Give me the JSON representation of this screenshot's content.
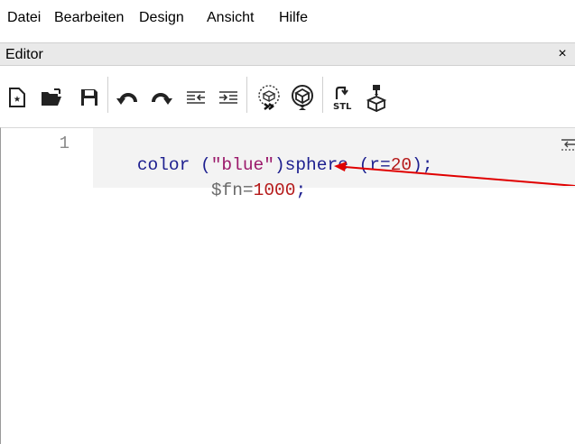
{
  "menu": [
    "Datei",
    "Bearbeiten",
    "Design",
    "Ansicht",
    "Hilfe"
  ],
  "panel": {
    "title": "Editor",
    "close_glyph": "×"
  },
  "toolbar": {
    "buttons": [
      {
        "name": "new-file-icon"
      },
      {
        "name": "open-file-icon"
      },
      {
        "name": "save-file-icon"
      },
      {
        "name": "undo-icon"
      },
      {
        "name": "redo-icon"
      },
      {
        "name": "unindent-icon"
      },
      {
        "name": "indent-icon"
      },
      {
        "name": "preview-icon"
      },
      {
        "name": "render-icon"
      },
      {
        "name": "export-stl-icon"
      },
      {
        "name": "send-to-print-icon"
      }
    ],
    "stl_label": "STL"
  },
  "editor": {
    "line_number": "1",
    "line1": {
      "t1": "color (",
      "t2": "\"blue\"",
      "t3": ")sphere (r=",
      "t4": "20",
      "t5": ");"
    },
    "line2": {
      "t1": "$fn=",
      "t2": "1000",
      "t3": ";"
    }
  },
  "colors": {
    "identifier": "#1d1f8f",
    "string": "#9b1a6b",
    "number": "#b51a1a",
    "annotation_arrow": "#e00000"
  }
}
